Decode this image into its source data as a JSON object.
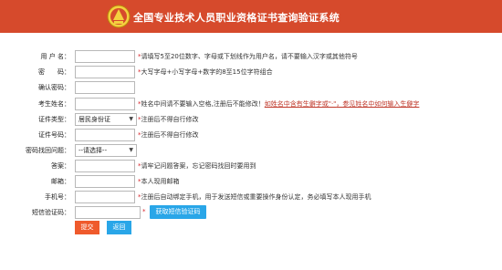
{
  "header": {
    "title": "全国专业技术人员职业资格证书查询验证系统"
  },
  "form": {
    "username": {
      "label": "用 户 名：",
      "hint": "*请填写5至20位数字、字母或下划线作为用户名，请不要输入汉字或其他符号"
    },
    "password": {
      "label": "密　　码：",
      "hint": "*大写字母+小写字母+数字的8至15位字符组合"
    },
    "confirm_password": {
      "label": "确认密码："
    },
    "name": {
      "label": "考生姓名：",
      "hint": "*姓名中间请不要输入空格,注册后不能修改！",
      "link1": "如姓名中含有生僻字或\"·\"",
      "link2": "，参见姓名中如何输入生僻字"
    },
    "id_type": {
      "label": "证件类型：",
      "value": "居民身份证",
      "hint": "*注册后不得自行修改"
    },
    "id_number": {
      "label": "证件号码：",
      "hint": "*注册后不得自行修改"
    },
    "security_question": {
      "label": "密码找回问题：",
      "value": "--请选择--"
    },
    "answer": {
      "label": "答案：",
      "hint": "*请牢记问题答案，忘记密码找回时要用到"
    },
    "email": {
      "label": "邮箱：",
      "hint": "*本人现用邮箱"
    },
    "phone": {
      "label": "手机号：",
      "hint": "*注册后自动绑定手机，用于发送短信或重要操作身份认定，务必填写本人现用手机"
    },
    "sms_code": {
      "label": "短信验证码：",
      "star": "*",
      "button": "获取短信验证码"
    }
  },
  "actions": {
    "submit": "提交",
    "back": "返回"
  },
  "colors": {
    "header_bg": "#d64a2c",
    "submit_bg": "#ef5a2c",
    "blue_button": "#29a6e8",
    "required": "#d9262c"
  }
}
